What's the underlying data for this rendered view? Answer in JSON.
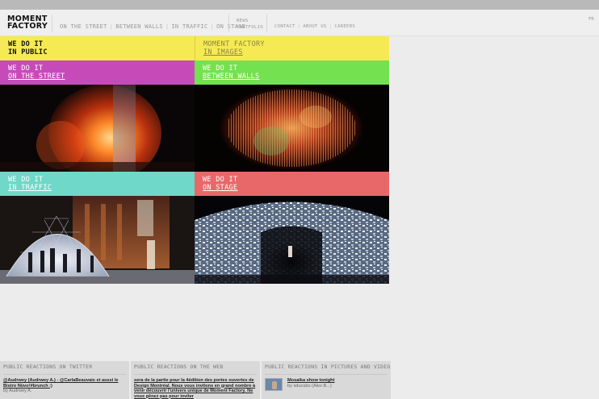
{
  "header": {
    "logo_line1": "MOMENT",
    "logo_line2": "FACTORY",
    "nav_main": [
      "ON THE STREET",
      "BETWEEN WALLS",
      "IN TRAFFIC",
      "ON STAGE"
    ],
    "nav_secondary": [
      "NEWS",
      "PORTFOLIO"
    ],
    "nav_corporate": [
      "CONTACT",
      "ABOUT US",
      "CAREERS"
    ],
    "language": "FR"
  },
  "tiles": {
    "public": {
      "line1": "WE DO IT",
      "line2": "IN PUBLIC"
    },
    "images": {
      "line1": "MOMENT FACTORY",
      "line2": "IN IMAGES"
    },
    "street": {
      "line1": "WE DO IT",
      "line2": "ON THE STREET"
    },
    "walls": {
      "line1": "WE DO IT",
      "line2": "BETWEEN WALLS"
    },
    "traffic": {
      "line1": "WE DO IT",
      "line2": "IN TRAFFIC"
    },
    "stage": {
      "line1": "WE DO IT",
      "line2": "ON STAGE"
    }
  },
  "colors": {
    "yellow": "#f6ea54",
    "magenta": "#c64bb9",
    "green": "#74e150",
    "teal": "#6fd8c8",
    "coral": "#e8686a"
  },
  "panels": {
    "twitter": {
      "title": "PUBLIC REACTIONS ON TWITTER",
      "tweet": "@Audrwey (Audrwey A.) - @CarlaBeauvais et aussi le Bistro Nüvo!#brunch :)",
      "author": "by Audrwey A."
    },
    "web": {
      "title": "PUBLIC REACTIONS ON THE WEB",
      "post": "sera de la partie pour la 4édition des portes ouvertes de Design Montréal. Nous vous invitons en grand nombre à venir découvrir l'univers unique de Moment Factory. Ne vous gênez pas pour inviter"
    },
    "pictures": {
      "title": "PUBLIC REACTIONS IN PICTURES AND VIDEOS",
      "item_title": "Mosaika show tonight",
      "item_author": "by sducubo (Alex B...)"
    }
  }
}
